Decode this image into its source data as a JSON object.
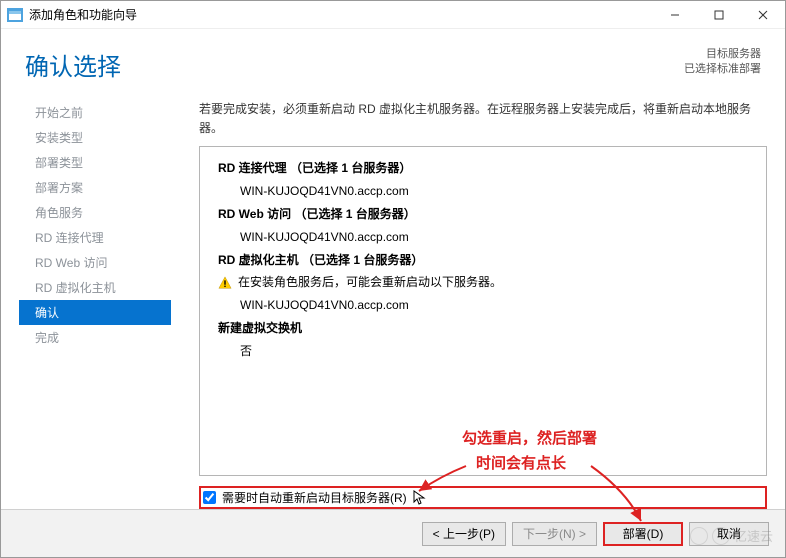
{
  "window": {
    "title": "添加角色和功能向导"
  },
  "header": {
    "page_title": "确认选择",
    "target_label": "目标服务器",
    "target_value": "已选择标准部署"
  },
  "sidebar": {
    "items": [
      {
        "label": "开始之前"
      },
      {
        "label": "安装类型"
      },
      {
        "label": "部署类型"
      },
      {
        "label": "部署方案"
      },
      {
        "label": "角色服务"
      },
      {
        "label": "RD 连接代理"
      },
      {
        "label": "RD Web 访问"
      },
      {
        "label": "RD 虚拟化主机"
      },
      {
        "label": "确认"
      },
      {
        "label": "完成"
      }
    ],
    "active_index": 8
  },
  "content": {
    "description": "若要完成安装，必须重新启动 RD 虚拟化主机服务器。在远程服务器上安装完成后，将重新启动本地服务器。",
    "groups": [
      {
        "title": "RD 连接代理 （已选择 1 台服务器）",
        "line": "WIN-KUJOQD41VN0.accp.com"
      },
      {
        "title": "RD Web 访问 （已选择 1 台服务器）",
        "line": "WIN-KUJOQD41VN0.accp.com"
      },
      {
        "title": "RD 虚拟化主机 （已选择 1 台服务器）",
        "warning": "在安装角色服务后，可能会重新启动以下服务器。",
        "line": "WIN-KUJOQD41VN0.accp.com"
      }
    ],
    "extra_title": "新建虚拟交换机",
    "extra_value": "否",
    "checkbox_label": "需要时自动重新启动目标服务器(R)",
    "checkbox_checked": true
  },
  "footer": {
    "prev": "< 上一步(P)",
    "next": "下一步(N) >",
    "deploy": "部署(D)",
    "cancel": "取消"
  },
  "annotation": {
    "line1": "勾选重启，然后部署",
    "line2": "时间会有点长"
  },
  "watermark": "亿速云"
}
